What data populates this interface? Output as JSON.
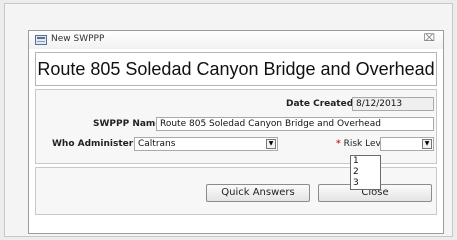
{
  "window": {
    "title": "New SWPPP",
    "close_glyph": "⌧"
  },
  "header": {
    "title": "Route 805 Soledad Canyon Bridge and Overhead"
  },
  "form": {
    "date_created_label": "Date Created:",
    "date_created_value": "8/12/2013",
    "swppp_name_label": "SWPPP Name:",
    "swppp_name_value": "Route 805 Soledad Canyon Bridge and Overhead",
    "who_administer_label": "Who Administer:",
    "who_administer_value": "Caltrans",
    "risk_level_required_mark": "*",
    "risk_level_label": "Risk Level",
    "risk_level_value": "",
    "risk_level_options": [
      "1",
      "2",
      "3"
    ]
  },
  "buttons": {
    "quick_answers": "Quick Answers",
    "close": "Close"
  },
  "icons": {
    "dropdown_arrow": "▼"
  }
}
